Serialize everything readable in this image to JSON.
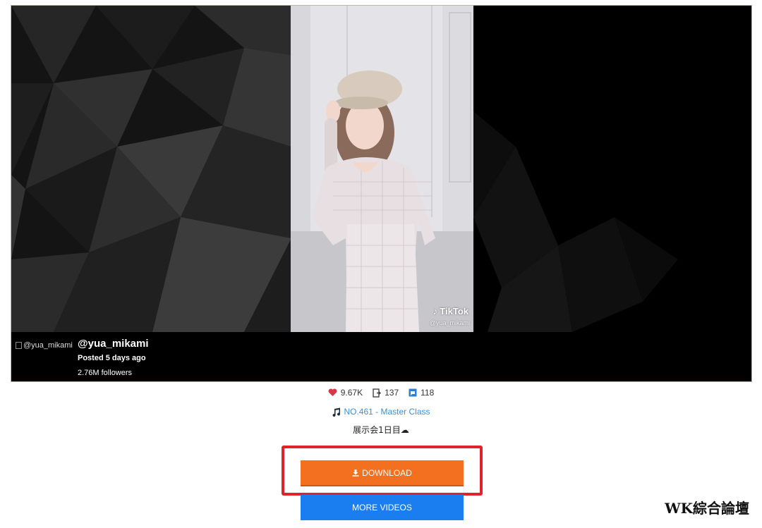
{
  "author": {
    "avatar_alt": "@yua_mikami",
    "name": "@yua_mikami",
    "posted": "Posted 5 days ago",
    "followers": "2.76M followers"
  },
  "video": {
    "watermark_brand": "TikTok",
    "watermark_handle": "@yua_mikami"
  },
  "stats": {
    "likes": "9.67K",
    "shares": "137",
    "comments": "118"
  },
  "music": {
    "label": "NO.461 - Master Class"
  },
  "description": "展示会1日目☁",
  "buttons": {
    "download": "DOWNLOAD",
    "more_videos": "MORE VIDEOS"
  },
  "site_watermark": "WK綜合論壇",
  "colors": {
    "download": "#f37021",
    "more_videos": "#1a7ef0",
    "highlight": "#e0222c",
    "link": "#3a8fd6"
  },
  "icons": {
    "likes": "heart-icon",
    "shares": "share-icon",
    "comments": "comment-icon",
    "music": "music-note-icon",
    "download": "download-icon"
  }
}
